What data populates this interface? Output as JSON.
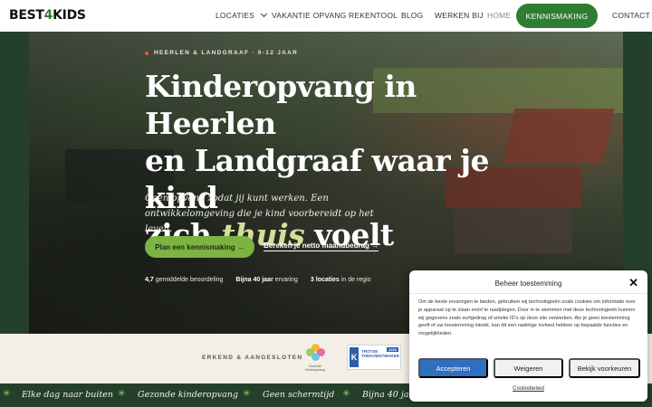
{
  "header": {
    "logo_prefix": "BEST",
    "logo_accent": "4",
    "logo_suffix": "KIDS",
    "nav": {
      "locaties": "LOCATIES",
      "vakantie": "VAKANTIE OPVANG",
      "rekentool": "REKENTOOL",
      "blog": "BLOG",
      "werken": "WERKEN BIJ",
      "home": "HOME",
      "cta": "KENNISMAKING",
      "contact": "CONTACT"
    }
  },
  "hero": {
    "eyebrow": "HEERLEN & LANDGRAAF · 0-12 JAAR",
    "headline_line1": "Kinderopvang in Heerlen",
    "headline_line2": "en Landgraaf waar je kind",
    "headline_line3_pre": "zich ",
    "headline_line3_em": "thuis",
    "headline_line3_post": " voelt",
    "subline": "Geen opvang zodat jij kunt werken. Een ontwikkelomgeving die je kind voorbereidt op het leven.",
    "cta_primary": "Plan een kennismaking →",
    "cta_secondary": "Bereken je netto maandbedrag →",
    "stats": [
      {
        "value": "4,7",
        "label": "gemiddelde beoordeling"
      },
      {
        "value": "Bijna 40 jaar",
        "label": "ervaring"
      },
      {
        "value": "3 locaties",
        "label": "in de regio"
      }
    ]
  },
  "accreditation": {
    "label": "ERKEND & AANGESLOTEN",
    "badge1_caption": "Gezonde Kinderopvang",
    "badge2_title": "TROTSE TOEKOMSTMAKER",
    "badge2_year": "2026"
  },
  "ticker": {
    "items": [
      "Elke dag naar buiten",
      "Gezonde kinderopvang",
      "Geen schermtijd",
      "Bijna 40 ja"
    ]
  },
  "cookie": {
    "title": "Beheer toestemming",
    "text": "Om de beste ervaringen te bieden, gebruiken wij technologieën zoals cookies om informatie over je apparaat op te slaan en/of te raadplegen. Door in te stemmen met deze technologieën kunnen wij gegevens zoals surfgedrag of unieke ID's op deze site verwerken. Als je geen toestemming geeft of uw toestemming intrekt, kan dit een nadelige invloed hebben op bepaalde functies en mogelijkheden.",
    "accept": "Accepteren",
    "deny": "Weigeren",
    "prefs": "Bekijk voorkeuren",
    "policy_link": "Cookiebeleid"
  },
  "colors": {
    "brand_green": "#2e7d32",
    "cta_lime": "#7cb342",
    "hero_bg": "#24402b",
    "accept_blue": "#2f6fbf"
  }
}
